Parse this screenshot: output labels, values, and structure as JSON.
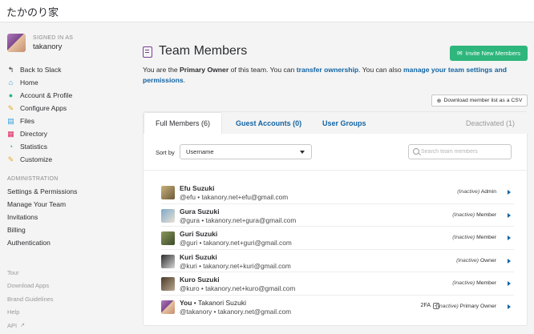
{
  "team": {
    "name": "たかのり家"
  },
  "user": {
    "signed_in_label": "SIGNED IN AS",
    "name": "takanory"
  },
  "nav": [
    {
      "label": "Back to Slack",
      "icon": "back-arrow-icon",
      "glyph": "↰",
      "color": "#2c2d30"
    },
    {
      "label": "Home",
      "icon": "home-icon",
      "glyph": "⌂",
      "color": "#2d9ee0"
    },
    {
      "label": "Account & Profile",
      "icon": "person-icon",
      "glyph": "●",
      "color": "#2eb67d"
    },
    {
      "label": "Configure Apps",
      "icon": "wrench-icon",
      "glyph": "✎",
      "color": "#e8a723"
    },
    {
      "label": "Files",
      "icon": "file-icon",
      "glyph": "▤",
      "color": "#2d9ee0"
    },
    {
      "label": "Directory",
      "icon": "directory-icon",
      "glyph": "▦",
      "color": "#e01e5a"
    },
    {
      "label": "Statistics",
      "icon": "statistics-icon",
      "glyph": "◔",
      "color": "#2eb67d"
    },
    {
      "label": "Customize",
      "icon": "customize-icon",
      "glyph": "✎",
      "color": "#e8a723"
    }
  ],
  "admin": {
    "heading": "ADMINISTRATION",
    "items": [
      "Settings & Permissions",
      "Manage Your Team",
      "Invitations",
      "Billing",
      "Authentication"
    ]
  },
  "footer": {
    "items": [
      "Tour",
      "Download Apps",
      "Brand Guidelines",
      "Help",
      "API"
    ]
  },
  "main": {
    "title": "Team Members",
    "invite_label": "Invite New Members",
    "desc_pre": "You are the ",
    "desc_role": "Primary Owner",
    "desc_mid": " of this team. You can ",
    "desc_link1": "transfer ownership",
    "desc_mid2": ". You can also ",
    "desc_link2": "manage your team settings and permissions",
    "desc_end": ".",
    "download_label": "Download member list as a CSV"
  },
  "tabs": {
    "full": "Full Members (6)",
    "guest": "Guest Accounts (0)",
    "groups": "User Groups",
    "deactivated": "Deactivated (1)"
  },
  "sort": {
    "label": "Sort by",
    "value": "Username"
  },
  "search": {
    "placeholder": "Search team members"
  },
  "members": [
    {
      "name": "Efu Suzuki",
      "extra": "",
      "sub": "@efu • takanory.net+efu@gmail.com",
      "status": "(Inactive)",
      "role": "Admin",
      "twofa": ""
    },
    {
      "name": "Gura Suzuki",
      "extra": "",
      "sub": "@gura • takanory.net+gura@gmail.com",
      "status": "(Inactive)",
      "role": "Member",
      "twofa": ""
    },
    {
      "name": "Guri Suzuki",
      "extra": "",
      "sub": "@guri • takanory.net+guri@gmail.com",
      "status": "(Inactive)",
      "role": "Member",
      "twofa": ""
    },
    {
      "name": "Kuri Suzuki",
      "extra": "",
      "sub": "@kuri • takanory.net+kuri@gmail.com",
      "status": "(Inactive)",
      "role": "Owner",
      "twofa": ""
    },
    {
      "name": "Kuro Suzuki",
      "extra": "",
      "sub": "@kuro • takanory.net+kuro@gmail.com",
      "status": "(Inactive)",
      "role": "Member",
      "twofa": ""
    },
    {
      "name": "You",
      "extra": " • Takanori Suzuki",
      "sub": "@takanory • takanory.net@gmail.com",
      "status": "(Inactive)",
      "role": "Primary Owner",
      "twofa": "2FA"
    }
  ]
}
